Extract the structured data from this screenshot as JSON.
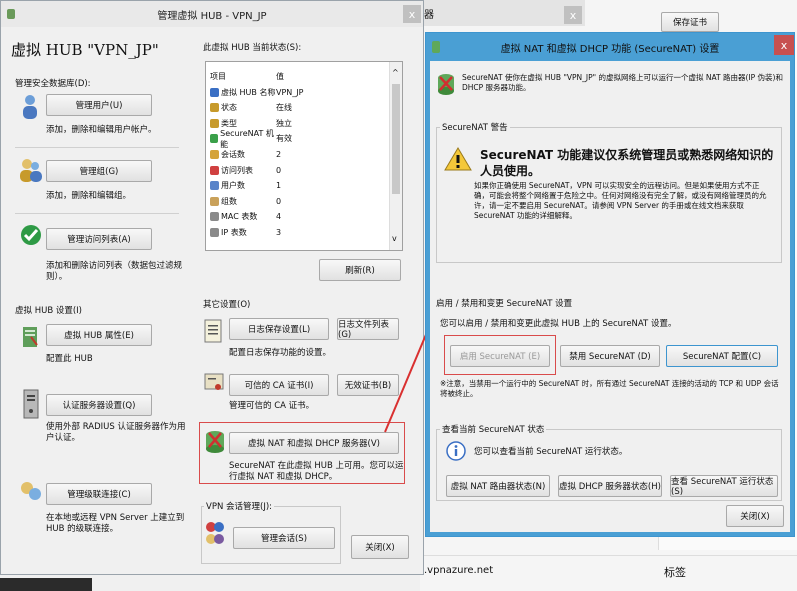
{
  "hub_window": {
    "title": "管理虚拟 HUB - VPN_JP",
    "heading": "虚拟 HUB \"VPN_JP\"",
    "security_group": "管理安全数据库(D):",
    "manage_users": {
      "button": "管理用户(U)",
      "desc": "添加，删除和编辑用户帐户。"
    },
    "manage_groups": {
      "button": "管理组(G)",
      "desc": "添加，删除和编辑组。"
    },
    "manage_access": {
      "button": "管理访问列表(A)",
      "desc": "添加和删除访问列表（数据包过滤规则）。"
    },
    "status_group": "此虚拟 HUB 当前状态(S):",
    "status_headers": [
      "项目",
      "值"
    ],
    "status_rows": [
      {
        "k": "虚拟 HUB 名称",
        "v": "VPN_JP",
        "color": "#3a6fc4"
      },
      {
        "k": "状态",
        "v": "在线",
        "color": "#c79a2b"
      },
      {
        "k": "类型",
        "v": "独立",
        "color": "#c79a2b"
      },
      {
        "k": "SecureNAT 机能",
        "v": "有效",
        "color": "#3aa04a"
      },
      {
        "k": "会话数",
        "v": "2",
        "color": "#d4a33a"
      },
      {
        "k": "访问列表",
        "v": "0",
        "color": "#d04040"
      },
      {
        "k": "用户数",
        "v": "1",
        "color": "#5a84c9"
      },
      {
        "k": "组数",
        "v": "0",
        "color": "#c9a15a"
      },
      {
        "k": "MAC 表数",
        "v": "4",
        "color": "#8a8a8a"
      },
      {
        "k": "IP 表数",
        "v": "3",
        "color": "#8a8a8a"
      }
    ],
    "refresh": "刷新(R)",
    "vhub_settings_group": "虚拟 HUB 设置(I)",
    "properties": {
      "button": "虚拟 HUB 属性(E)",
      "desc": "配置此 HUB"
    },
    "radius": {
      "button": "认证服务器设置(Q)",
      "desc": "使用外部 RADIUS 认证服务器作为用户认证。"
    },
    "cascade": {
      "button": "管理级联连接(C)",
      "desc": "在本地或远程 VPN Server 上建立到 HUB 的级联连接。"
    },
    "other_group": "其它设置(O)",
    "log_save": "日志保存设置(L)",
    "log_list": "日志文件列表(G)",
    "log_desc": "配置日志保存功能的设置。",
    "ca_cert": "可信的 CA 证书(I)",
    "crl": "无效证书(B)",
    "ca_desc": "管理可信的 CA 证书。",
    "securenat_btn": "虚拟 NAT 和虚拟 DHCP 服务器(V)",
    "securenat_desc": "SecureNAT 在此虚拟 HUB 上可用。您可以运行虚拟 NAT 和虚拟 DHCP。",
    "session_group": "VPN 会话管理(J):",
    "manage_sessions": "管理会话(S)",
    "close": "关闭(X)"
  },
  "behind": {
    "title_frag": "器",
    "save_cert": "保存证书",
    "footer_text": ".vpnazure.net",
    "label_right": "标签"
  },
  "nat_window": {
    "title": "虚拟 NAT 和虚拟 DHCP 功能 (SecureNAT) 设置",
    "intro": "SecureNAT 使你在虚拟 HUB \"VPN_JP\" 的虚拟网络上可以运行一个虚拟 NAT 路由器(IP 伪装)和 DHCP 服务器功能。",
    "warning_group": "SecureNAT 警告",
    "warning_headline": "SecureNAT 功能建议仅系统管理员或熟悉网络知识的人员使用。",
    "warning_body": "如果你正确使用 SecureNAT，VPN 可以实现安全的远程访问。但是如果使用方式不正确，可能会将整个网络置于危险之中。任何对网络没有完全了解，或没有网络管理员的允许，请一定不要启用 SecureNAT。请参阅 VPN Server 的手册或在线文档来获取 SecureNAT 功能的详细解释。",
    "enable_group": "启用 / 禁用和变更 SecureNAT 设置",
    "enable_desc": "您可以启用 / 禁用和变更此虚拟 HUB 上的 SecureNAT 设置。",
    "enable_btn": "启用 SecureNAT (E)",
    "disable_btn": "禁用 SecureNAT (D)",
    "config_btn": "SecureNAT 配置(C)",
    "note": "※注意，当禁用一个运行中的 SecureNAT 时，所有通过 SecureNAT 连接的活动的 TCP 和 UDP 会话将被终止。",
    "status_group": "查看当前 SecureNAT 状态",
    "status_desc": "您可以查看当前 SecureNAT 运行状态。",
    "nat_table_btn": "虚拟 NAT 路由器状态(N)",
    "dhcp_table_btn": "虚拟 DHCP 服务器状态(H)",
    "status_btn": "查看 SecureNAT 运行状态(S)",
    "close": "关闭(X)"
  },
  "colors": {
    "accent": "#2e88c7",
    "highlight": "#d94b4b",
    "nat_title": "#3d95cf"
  }
}
